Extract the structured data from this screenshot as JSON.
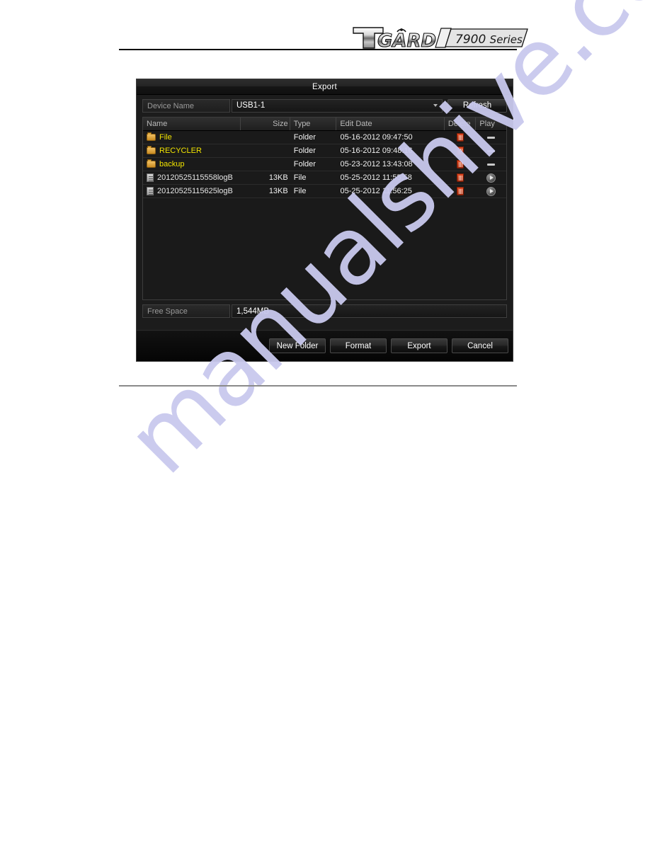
{
  "page": {
    "brand_logo_text": "TGARD",
    "brand_series_text": "7900 Series"
  },
  "watermark": {
    "text": "manualshive.com",
    "color": "#c9c9ee"
  },
  "dialog": {
    "title": "Export",
    "device": {
      "label": "Device Name",
      "value": "USB1-1",
      "dropdown_icon": "chevron-down-icon"
    },
    "refresh_label": "Refresh",
    "table": {
      "headers": {
        "name": "Name",
        "size": "Size",
        "type": "Type",
        "date": "Edit Date",
        "delete": "Delete",
        "play": "Play"
      },
      "rows": [
        {
          "icon": "folder-icon",
          "name": "File",
          "size": "",
          "type": "Folder",
          "date": "05-16-2012 09:47:50",
          "delete_icon": "trash-icon",
          "play_icon": "dash-icon",
          "is_folder": true
        },
        {
          "icon": "folder-icon",
          "name": "RECYCLER",
          "size": "",
          "type": "Folder",
          "date": "05-16-2012 09:48:16",
          "delete_icon": "trash-icon",
          "play_icon": "dash-icon",
          "is_folder": true
        },
        {
          "icon": "folder-icon",
          "name": "backup",
          "size": "",
          "type": "Folder",
          "date": "05-23-2012 13:43:08",
          "delete_icon": "trash-icon",
          "play_icon": "dash-icon",
          "is_folder": true
        },
        {
          "icon": "file-icon",
          "name": "20120525115558logB",
          "size": "13KB",
          "type": "File",
          "date": "05-25-2012 11:55:58",
          "delete_icon": "trash-icon",
          "play_icon": "play-icon",
          "is_folder": false
        },
        {
          "icon": "file-icon",
          "name": "20120525115625logB",
          "size": "13KB",
          "type": "File",
          "date": "05-25-2012 11:56:25",
          "delete_icon": "trash-icon",
          "play_icon": "play-icon",
          "is_folder": false
        }
      ]
    },
    "free_space": {
      "label": "Free Space",
      "value": "1,544MB"
    },
    "buttons": {
      "new_folder": "New Folder",
      "format": "Format",
      "export": "Export",
      "cancel": "Cancel"
    }
  }
}
